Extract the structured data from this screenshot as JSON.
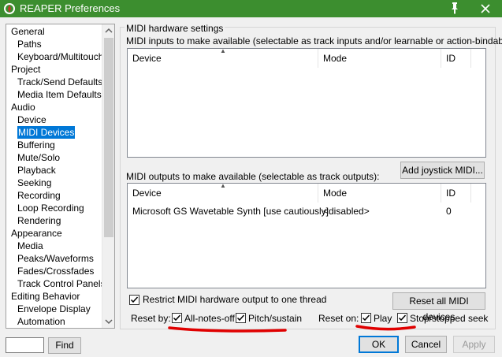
{
  "window": {
    "title": "REAPER Preferences"
  },
  "tree": {
    "items": [
      {
        "label": "General",
        "level": 0
      },
      {
        "label": "Paths",
        "level": 1
      },
      {
        "label": "Keyboard/Multitouch",
        "level": 1
      },
      {
        "label": "Project",
        "level": 0
      },
      {
        "label": "Track/Send Defaults",
        "level": 1
      },
      {
        "label": "Media Item Defaults",
        "level": 1
      },
      {
        "label": "Audio",
        "level": 0
      },
      {
        "label": "Device",
        "level": 1
      },
      {
        "label": "MIDI Devices",
        "level": 1,
        "selected": true
      },
      {
        "label": "Buffering",
        "level": 1
      },
      {
        "label": "Mute/Solo",
        "level": 1
      },
      {
        "label": "Playback",
        "level": 1
      },
      {
        "label": "Seeking",
        "level": 1
      },
      {
        "label": "Recording",
        "level": 1
      },
      {
        "label": "Loop Recording",
        "level": 1
      },
      {
        "label": "Rendering",
        "level": 1
      },
      {
        "label": "Appearance",
        "level": 0
      },
      {
        "label": "Media",
        "level": 1
      },
      {
        "label": "Peaks/Waveforms",
        "level": 1
      },
      {
        "label": "Fades/Crossfades",
        "level": 1
      },
      {
        "label": "Track Control Panels",
        "level": 1
      },
      {
        "label": "Editing Behavior",
        "level": 0
      },
      {
        "label": "Envelope Display",
        "level": 1
      },
      {
        "label": "Automation",
        "level": 1
      }
    ]
  },
  "find": {
    "value": "",
    "button_label": "Find"
  },
  "midi": {
    "group_label": "MIDI hardware settings",
    "inputs_label": "MIDI inputs to make available (selectable as track inputs and/or learnable or action-bindable):",
    "inputs_columns": [
      "Device",
      "Mode",
      "ID"
    ],
    "outputs_label": "MIDI outputs to make available (selectable as track outputs):",
    "add_joystick_label": "Add joystick MIDI...",
    "outputs_columns": [
      "Device",
      "Mode",
      "ID"
    ],
    "outputs_rows": [
      {
        "device": "Microsoft GS Wavetable Synth [use cautiously]",
        "mode": "<disabled>",
        "id": "0"
      }
    ],
    "restrict_label": "Restrict MIDI hardware output to one thread",
    "restrict_checked": true,
    "reset_all_label": "Reset all MIDI devices",
    "reset_by_label": "Reset by:",
    "all_notes_off_label": "All-notes-off",
    "all_notes_off_checked": true,
    "pitch_sustain_label": "Pitch/sustain",
    "pitch_sustain_checked": true,
    "reset_on_label": "Reset on:",
    "play_label": "Play",
    "play_checked": true,
    "stop_seek_label": "Stop/stopped seek",
    "stop_seek_checked": true
  },
  "buttons": {
    "ok": "OK",
    "cancel": "Cancel",
    "apply": "Apply"
  },
  "colors": {
    "titlebar": "#3c8e2f",
    "selection": "#0078d7",
    "annotation": "#e00000"
  },
  "icons": {
    "app": "reaper-logo-icon",
    "pin": "pin-icon",
    "close": "close-icon"
  }
}
